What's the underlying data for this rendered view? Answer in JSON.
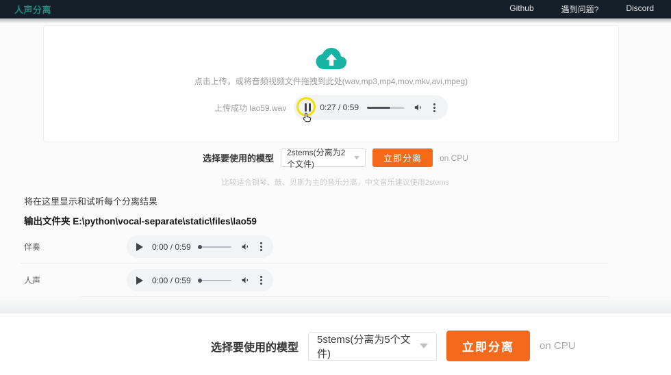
{
  "navbar": {
    "title": "人声分离",
    "links": [
      {
        "label": "Github"
      },
      {
        "label": "遇到问题?"
      },
      {
        "label": "Discord"
      }
    ]
  },
  "upload": {
    "hint": "点击上传，或将音频视频文件拖拽到此处(wav,mp3,mp4,mov,mkv,avi,mpeg)",
    "status": "上传成功 lao59.wav",
    "player": {
      "time": "0:27 / 0:59",
      "progress_pct": 62
    }
  },
  "separator": {
    "label": "选择要使用的模型",
    "selected_model": "2stems(分离为2个文件)",
    "button_label": "立即分离",
    "device": "on CPU",
    "note": "比较适合钢琴、鼓、贝斯为主的音乐分离，中文音乐建议使用2stems"
  },
  "results": {
    "heading": "将在这里显示和试听每个分离结果",
    "output_folder_label": "输出文件夹",
    "output_folder_path": "E:\\python\\vocal-separate\\static\\files\\lao59",
    "items": [
      {
        "label": "伴奏",
        "player": {
          "time": "0:00 / 0:59",
          "progress_pct": 0
        }
      },
      {
        "label": "人声",
        "player": {
          "time": "0:00 / 0:59",
          "progress_pct": 0
        }
      }
    ]
  },
  "bottom_panel": {
    "label": "选择要使用的模型",
    "selected_model": "5stems(分离为5个文件)",
    "button_label": "立即分离",
    "device": "on CPU"
  },
  "colors": {
    "accent_orange": "#f5691d",
    "brand_teal": "#1c8a7c",
    "upload_icon_teal": "#17b3a3",
    "navbar_bg": "#141f29",
    "click_highlight": "#f3df07"
  }
}
